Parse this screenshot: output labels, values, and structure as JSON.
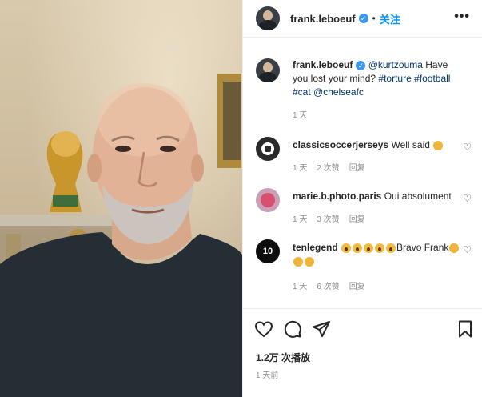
{
  "post": {
    "username": "frank.leboeuf",
    "verified_mark": "✓",
    "dot": "•",
    "follow_label": "关注",
    "more_label": "•••",
    "caption": {
      "mention": "@kurtzouma",
      "text": " Have you lost your mind? ",
      "tags": [
        "#torture",
        "#football",
        "#cat"
      ],
      "mention2": "@chelseafc",
      "time": "1 天"
    }
  },
  "comments": [
    {
      "user": "classicsoccerjerseys",
      "text": "Well said",
      "emoji": "clap-icon",
      "time": "1 天",
      "likes": "2 次赞",
      "reply": "回复"
    },
    {
      "user": "marie.b.photo.paris",
      "text": "Oui absolument",
      "time": "1 天",
      "likes": "3 次赞",
      "reply": "回复"
    },
    {
      "user": "tenlegend",
      "text_before": "",
      "text": "Bravo Frank",
      "emoji_count_scream": 5,
      "emoji_count_clap": 3,
      "time": "1 天",
      "likes": "6 次赞",
      "reply": "回复",
      "avatar_text": "10"
    }
  ],
  "stats": {
    "views": "1.2万 次播放",
    "posted": "1 天前"
  },
  "icons": [
    "heart-icon",
    "comment-icon",
    "share-icon",
    "bookmark-icon",
    "more-icon",
    "verified-icon"
  ],
  "colors": {
    "link": "#0095f6",
    "verified": "#3897f0",
    "muted": "#8e8e8e",
    "text": "#262626"
  }
}
